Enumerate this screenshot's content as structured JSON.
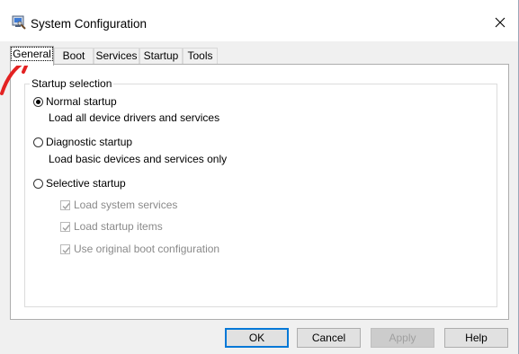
{
  "window": {
    "title": "System Configuration"
  },
  "tabs": [
    {
      "label": "General",
      "active": true
    },
    {
      "label": "Boot"
    },
    {
      "label": "Services"
    },
    {
      "label": "Startup"
    },
    {
      "label": "Tools"
    }
  ],
  "general": {
    "group_label": "Startup selection",
    "options": [
      {
        "label": "Normal startup",
        "description": "Load all device drivers and services",
        "selected": true
      },
      {
        "label": "Diagnostic startup",
        "description": "Load basic devices and services only",
        "selected": false
      },
      {
        "label": "Selective startup",
        "selected": false
      }
    ],
    "selective_items": [
      {
        "label": "Load system services",
        "checked": true,
        "enabled": false
      },
      {
        "label": "Load startup items",
        "checked": true,
        "enabled": false
      },
      {
        "label": "Use original boot configuration",
        "checked": true,
        "enabled": false
      }
    ]
  },
  "buttons": {
    "ok": "OK",
    "cancel": "Cancel",
    "apply": "Apply",
    "help": "Help"
  },
  "icons": {
    "app": "system-configuration-icon",
    "close": "close-icon",
    "annotation": "red-arrow-annotation"
  },
  "colors": {
    "annotation": "#e32222",
    "default_button_border": "#0078d7"
  }
}
